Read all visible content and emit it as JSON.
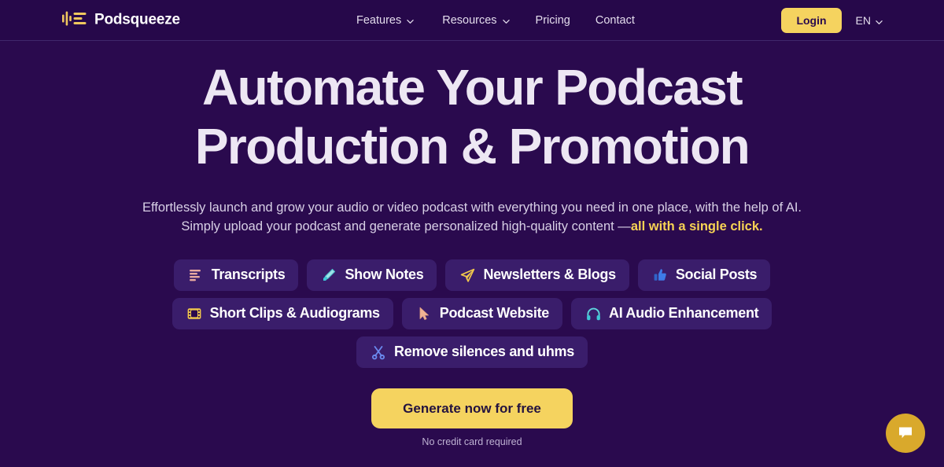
{
  "header": {
    "brand": {
      "name": "Podsqueeze",
      "logo_icon": "audio-bars-lines-icon",
      "logo_color": "#F0C75E"
    },
    "nav": [
      {
        "label": "Features",
        "icon": "chevron-down-icon",
        "has_caret": true
      },
      {
        "label": "Resources",
        "icon": "chevron-down-icon",
        "has_caret": true
      },
      {
        "label": "Pricing",
        "has_caret": false
      },
      {
        "label": "Contact",
        "has_caret": false
      }
    ],
    "login_label": "Login",
    "language": {
      "label": "EN",
      "icon": "chevron-down-icon"
    },
    "accent_color": "#F5D35F",
    "background_color": "#26084A"
  },
  "hero": {
    "headline_line1": "Automate Your Podcast",
    "headline_line2": "Production & Promotion",
    "subhead_line1": "Effortlessly launch and grow your audio or video podcast with everything you need in one place, with the help of AI.",
    "subhead_line2_prefix": "Simply upload your podcast and generate personalized high-quality content —",
    "subhead_emphasis": "all with a single click.",
    "background_color": "#2A0A4E",
    "headline_color": "#EDE7F3",
    "emphasis_color": "#F7D354"
  },
  "pills": [
    {
      "label": "Transcripts",
      "icon": "text-lines-icon",
      "icon_color": "#E9A9A0"
    },
    {
      "label": "Show Notes",
      "icon": "highlighter-pen-icon",
      "icon_color": "#5FD6DE"
    },
    {
      "label": "Newsletters & Blogs",
      "icon": "paper-plane-icon",
      "icon_color": "#F2C94C"
    },
    {
      "label": "Social Posts",
      "icon": "thumbs-up-icon",
      "icon_color": "#3E7BE8"
    },
    {
      "label": "Short Clips & Audiograms",
      "icon": "film-strip-icon",
      "icon_color": "#F2C94C"
    },
    {
      "label": "Podcast Website",
      "icon": "cursor-arrow-icon",
      "icon_color": "#F0B394"
    },
    {
      "label": "AI Audio Enhancement",
      "icon": "headphones-icon",
      "icon_color": "#5FD6DE"
    },
    {
      "label": "Remove silences and uhms",
      "icon": "scissors-icon",
      "icon_color": "#6B8BF0"
    }
  ],
  "cta": {
    "button_label": "Generate now for free",
    "note": "No credit card required",
    "button_color": "#F5D35F"
  },
  "chat": {
    "icon": "chat-bubble-icon",
    "background_color": "#D9A92C"
  }
}
